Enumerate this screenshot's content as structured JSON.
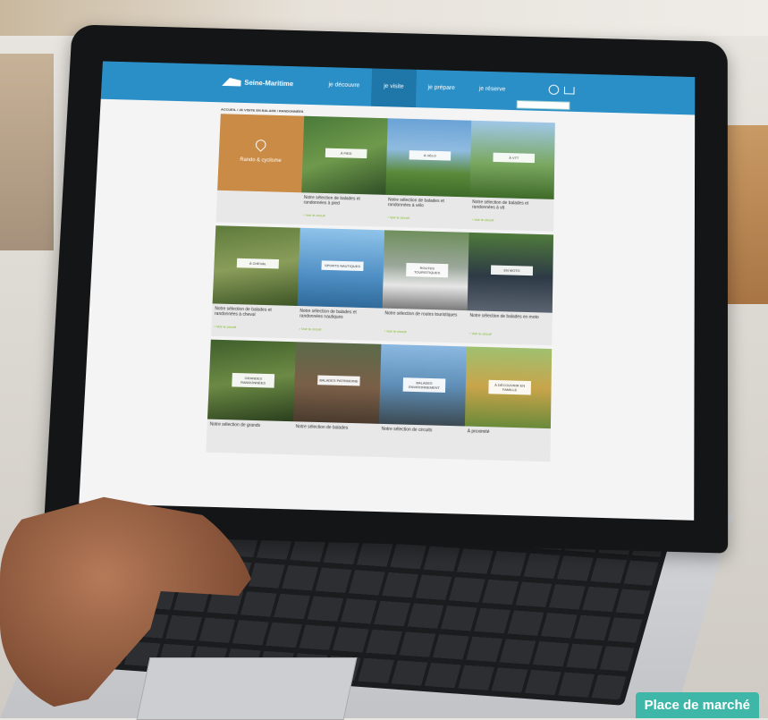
{
  "badge_label": "Place de marché",
  "site": {
    "logo_text": "Seine-Maritime",
    "nav": [
      "je découvre",
      "je visite",
      "je prépare",
      "je réserve"
    ],
    "breadcrumb": "ACCUEIL / JE VISITE EN BALADE / RANDONNÉES"
  },
  "tiles": [
    {
      "label": "Rando & cyclisme",
      "desc": "",
      "link": ""
    },
    {
      "label": "À PIED",
      "desc": "Notre sélection de balades et randonnées à pied",
      "link": "› Voir le circuit"
    },
    {
      "label": "À VÉLO",
      "desc": "Notre sélection de balades et randonnées à vélo",
      "link": "› Voir le circuit"
    },
    {
      "label": "À VTT",
      "desc": "Notre sélection de balades et randonnées à vtt",
      "link": "› Voir le circuit"
    },
    {
      "label": "À CHEVAL",
      "desc": "Notre sélection de balades et randonnées à cheval",
      "link": "› Voir le circuit"
    },
    {
      "label": "SPORTS NAUTIQUES",
      "desc": "Notre sélection de balades et randonnées nautiques",
      "link": "› Voir le circuit"
    },
    {
      "label": "ROUTES TOURISTIQUES",
      "desc": "Notre sélection de routes touristiques",
      "link": "› Voir le circuit"
    },
    {
      "label": "EN MOTO",
      "desc": "Notre sélection de balades en moto",
      "link": "› Voir le circuit"
    },
    {
      "label": "GRANDES RANDONNÉES",
      "desc": "Notre sélection de grands",
      "link": ""
    },
    {
      "label": "BALADES PATRIMOINE",
      "desc": "Notre sélection de balades",
      "link": ""
    },
    {
      "label": "BALADES ENVIRONNEMENT",
      "desc": "Notre sélection de circuits",
      "link": ""
    },
    {
      "label": "À DÉCOUVRIR EN FAMILLE",
      "desc": "À proximité",
      "link": ""
    }
  ],
  "colors": {
    "header": "#2b8fc7",
    "accent_orange": "#c98b46",
    "badge": "#3fb7a8"
  }
}
